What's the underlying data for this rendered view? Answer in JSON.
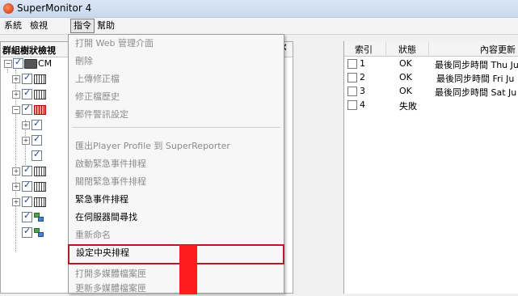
{
  "window": {
    "title": "SuperMonitor 4"
  },
  "menubar": {
    "items": [
      "系統",
      "檢視",
      "指令",
      "幫助"
    ]
  },
  "left_pane": {
    "title": "群組樹狀檢視",
    "close_glyph": "✕",
    "root_label": "CM"
  },
  "table": {
    "headers": [
      "索引",
      "狀態",
      "內容更新"
    ],
    "rows": [
      {
        "index": "1",
        "status": "OK",
        "content": "最後同步時間 Thu Ju"
      },
      {
        "index": "2",
        "status": "OK",
        "content": "最後同步時間 Fri Ju"
      },
      {
        "index": "3",
        "status": "OK",
        "content": "最後同步時間 Sat Ju"
      },
      {
        "index": "4",
        "status": "失敗",
        "content": ""
      }
    ]
  },
  "command_menu": {
    "items": [
      {
        "label": "打開 Web 管理介面",
        "enabled": false
      },
      {
        "label": "刪除",
        "enabled": false
      },
      {
        "label": "上傳修正檔",
        "enabled": false
      },
      {
        "label": "修正檔歷史",
        "enabled": false
      },
      {
        "label": "郵件警訊設定",
        "enabled": false
      },
      {
        "label": "匯出Player Profile 到 SuperReporter",
        "enabled": false
      },
      {
        "label": "啟動緊急事件排程",
        "enabled": false
      },
      {
        "label": "關閉緊急事件排程",
        "enabled": false
      },
      {
        "label": "緊急事件排程",
        "enabled": true
      },
      {
        "label": "在伺服器間尋找",
        "enabled": true
      },
      {
        "label": "重新命名",
        "enabled": false
      },
      {
        "label": "設定中央排程",
        "enabled": true,
        "highlighted": true
      },
      {
        "label": "打開多媒體檔案匣",
        "enabled": false
      },
      {
        "label": "更新多媒體檔案匣",
        "enabled": false
      }
    ]
  },
  "colors": {
    "highlight_border": "#b01e24",
    "redaction": "#ff1c1c"
  }
}
